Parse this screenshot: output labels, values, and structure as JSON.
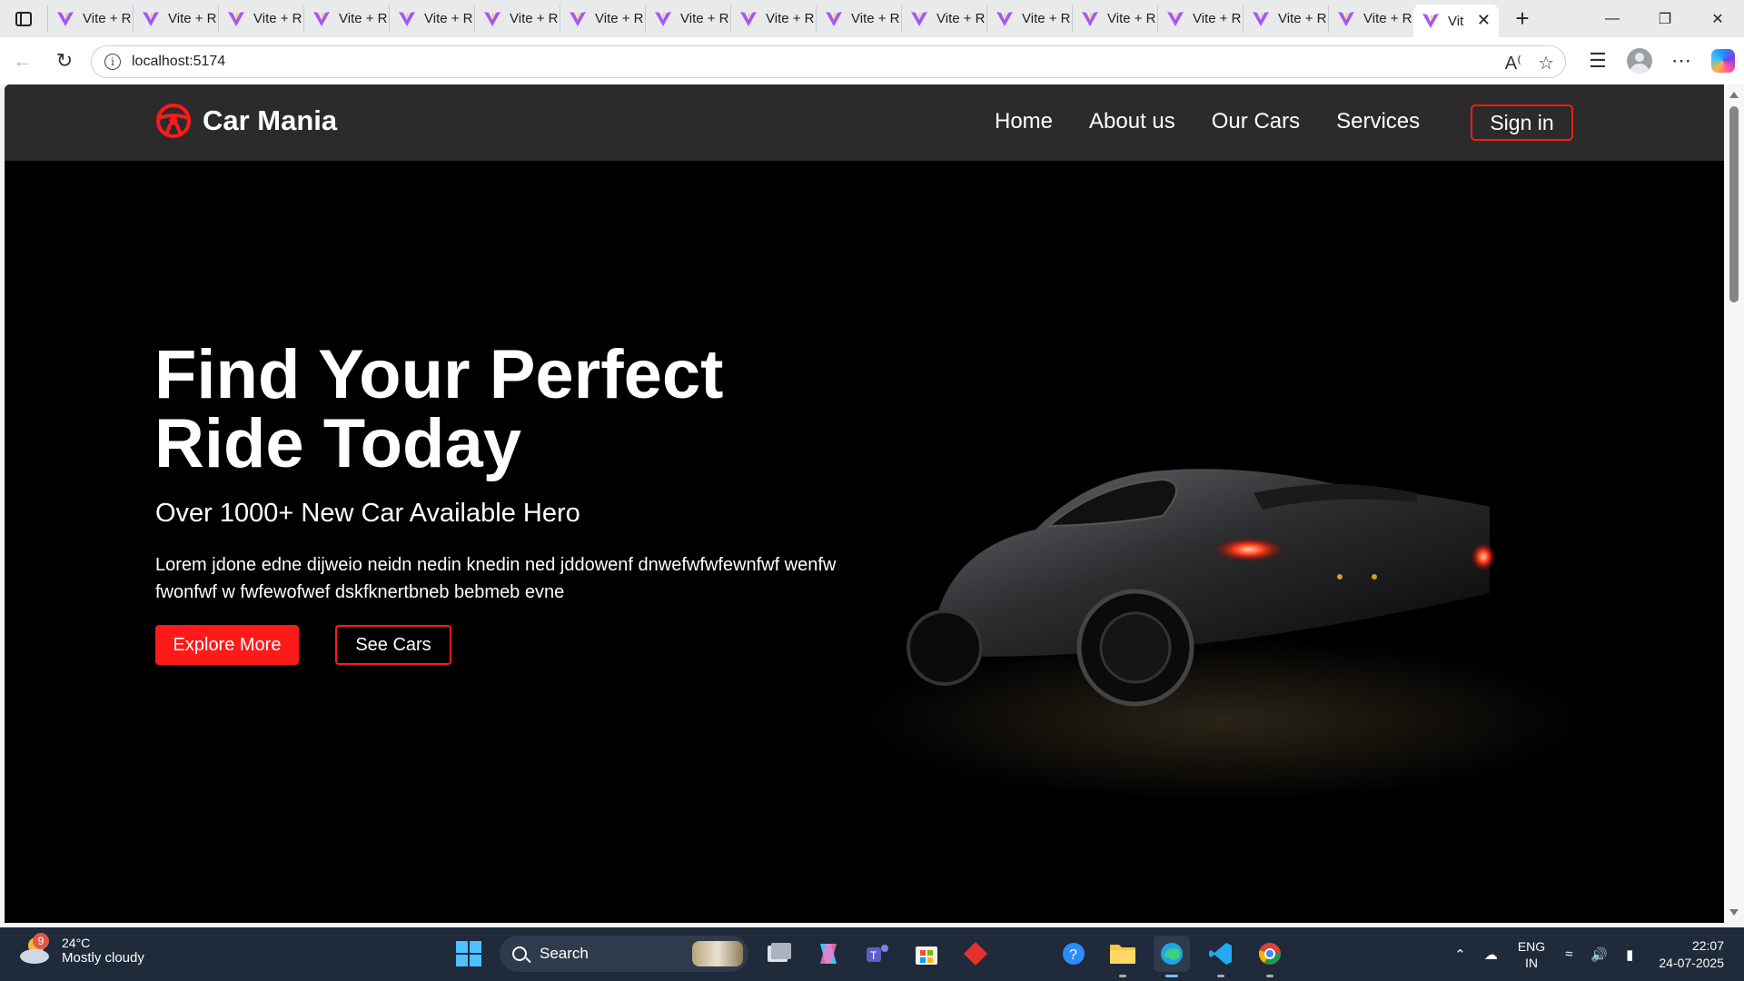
{
  "browser": {
    "tabs": [
      {
        "title": "Vite + R"
      },
      {
        "title": "Vite + R"
      },
      {
        "title": "Vite + R"
      },
      {
        "title": "Vite + R"
      },
      {
        "title": "Vite + R"
      },
      {
        "title": "Vite + R"
      },
      {
        "title": "Vite + R"
      },
      {
        "title": "Vite + R"
      },
      {
        "title": "Vite + R"
      },
      {
        "title": "Vite + R"
      },
      {
        "title": "Vite + R"
      },
      {
        "title": "Vite + R"
      },
      {
        "title": "Vite + R"
      },
      {
        "title": "Vite + R"
      },
      {
        "title": "Vite + R"
      },
      {
        "title": "Vite + R"
      }
    ],
    "active_tab": {
      "title": "Vit"
    },
    "url": "localhost:5174"
  },
  "navbar": {
    "brand": "Car Mania",
    "links": [
      "Home",
      "About us",
      "Our Cars",
      "Services"
    ],
    "signin": "Sign in"
  },
  "hero": {
    "title_line1": "Find Your Perfect",
    "title_line2": "Ride Today",
    "subtitle": "Over 1000+ New Car Available Hero",
    "description": "Lorem jdone edne dijweio neidn nedin knedin ned jddowenf dnwefwfwfewnfwf wenfw fwonfwf w fwfewofwef dskfknertbneb bebmeb evne",
    "explore_label": "Explore More",
    "see_cars_label": "See Cars"
  },
  "taskbar": {
    "weather_badge": "9",
    "temperature": "24°C",
    "weather_desc": "Mostly cloudy",
    "search_label": "Search",
    "lang_line1": "ENG",
    "lang_line2": "IN",
    "time": "22:07",
    "date": "24-07-2025"
  },
  "colors": {
    "accent": "#ff1a1a",
    "navbar_bg": "#2b2b2b",
    "hero_bg": "#000000"
  }
}
